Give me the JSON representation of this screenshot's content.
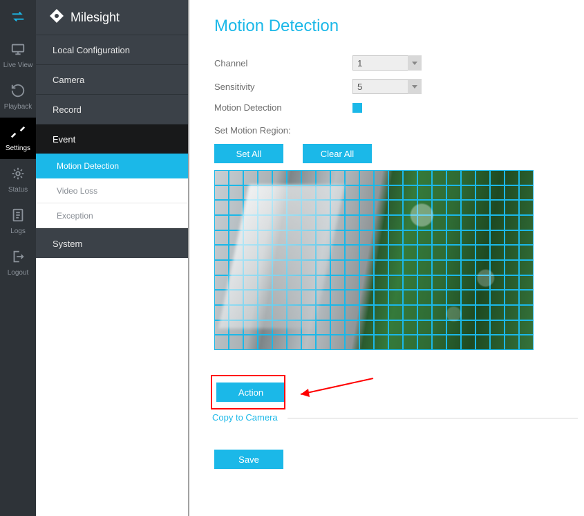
{
  "brand": "Milesight",
  "left_nav": {
    "live": "Live View",
    "playback": "Playback",
    "settings": "Settings",
    "status": "Status",
    "logs": "Logs",
    "logout": "Logout"
  },
  "mid_nav": {
    "local_config": "Local Configuration",
    "camera": "Camera",
    "record": "Record",
    "event": "Event",
    "event_sub": {
      "motion": "Motion Detection",
      "video_loss": "Video Loss",
      "exception": "Exception"
    },
    "system": "System"
  },
  "page": {
    "title": "Motion Detection",
    "channel_label": "Channel",
    "channel_value": "1",
    "sensitivity_label": "Sensitivity",
    "sensitivity_value": "5",
    "motion_det_label": "Motion Detection",
    "set_region_label": "Set Motion Region:",
    "set_all": "Set All",
    "clear_all": "Clear All",
    "action": "Action",
    "copy": "Copy to Camera",
    "save": "Save"
  },
  "annotation": {
    "highlight": "red-box-around-action",
    "arrow": "red-arrow-pointing-to-action"
  }
}
